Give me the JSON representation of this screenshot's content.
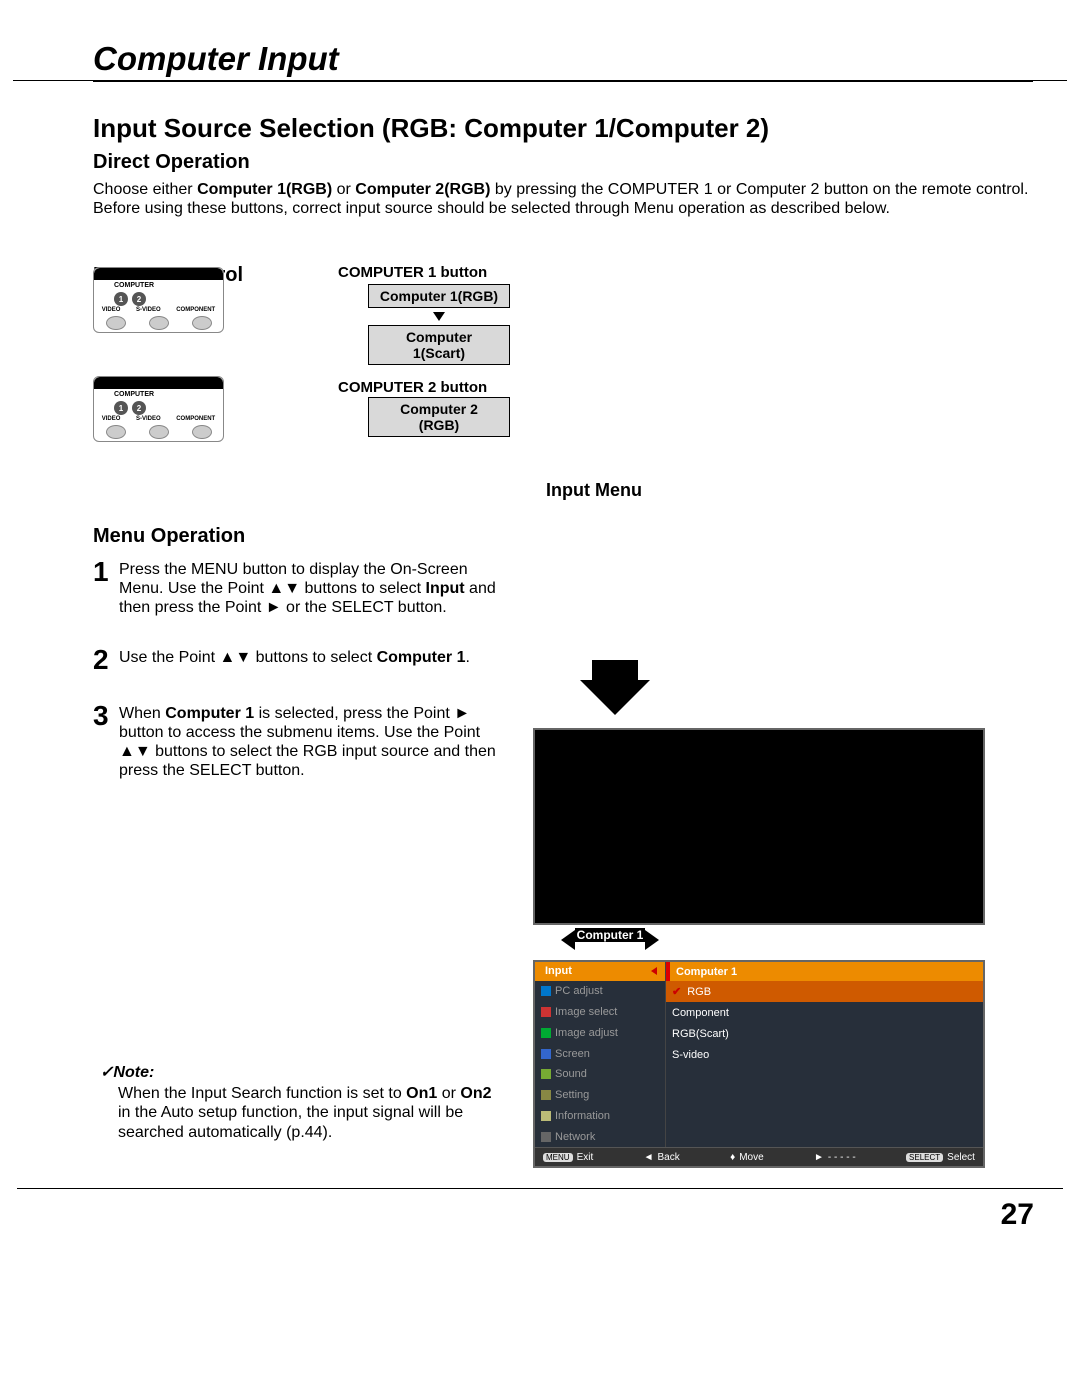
{
  "page": {
    "title": "Computer Input",
    "section": "Input Source Selection (RGB: Computer 1/Computer 2)",
    "number": "27"
  },
  "direct": {
    "heading": "Direct Operation",
    "p1a": "Choose either ",
    "p1b": "Computer 1(RGB)",
    "p1c": " or ",
    "p1d": "Computer 2(RGB)",
    "p1e": " by pressing the COMPUTER 1 or Computer 2 button on the remote control.",
    "p2": "Before using these buttons, correct input source should be selected through Menu operation as described below."
  },
  "remote": {
    "heading": "Remote Control",
    "comp1button": "COMPUTER 1 button",
    "comp2button": "COMPUTER 2 button",
    "pill_c1rgb": "Computer 1(RGB)",
    "pill_c1scart": "Computer 1(Scart)",
    "pill_c2rgb": "Computer 2 (RGB)",
    "labels": {
      "computer": "COMPUTER",
      "video": "VIDEO",
      "svideo": "S-VIDEO",
      "component": "COMPONENT",
      "n1": "1",
      "n2": "2"
    }
  },
  "inputmenu": {
    "heading": "Input Menu"
  },
  "menuop": {
    "heading": "Menu Operation",
    "s1a": "Press the MENU button to display the On-Screen Menu. Use the Point ▲▼ buttons to select ",
    "s1b": "Input",
    "s1c": " and then press the Point ► or the SELECT button.",
    "s2a": "Use the Point ▲▼ buttons to select ",
    "s2b": "Computer 1",
    "s2c": ".",
    "s3a": "When ",
    "s3b": "Computer 1",
    "s3c": " is selected, press the Point ► button to access the submenu items. Use the Point ▲▼ buttons to select the RGB input source and then press the SELECT button."
  },
  "submenu": {
    "diagram_label": "Computer 1"
  },
  "osd": {
    "left_header": "Input",
    "right_header": "Computer 1",
    "left_items": [
      "PC adjust",
      "Image select",
      "Image adjust",
      "Screen",
      "Sound",
      "Setting",
      "Information",
      "Network"
    ],
    "right_items": [
      "RGB",
      "Component",
      "RGB(Scart)",
      "S-video"
    ],
    "bottom": {
      "exit": "Exit",
      "menu": "MENU",
      "back": "Back",
      "move": "Move",
      "dashes": "- - - - -",
      "select_btn": "SELECT",
      "select": "Select"
    }
  },
  "note": {
    "heading": "Note:",
    "body_a": "When the Input Search function is set to ",
    "body_b": "On1",
    "body_c": " or ",
    "body_d": "On2",
    "body_e": " in the Auto setup function, the input signal will be searched automatically (p.44)."
  }
}
